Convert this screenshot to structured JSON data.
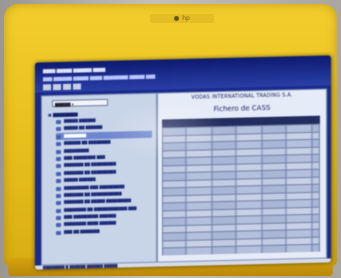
{
  "monitor": {
    "brand_logo": "hp"
  },
  "app": {
    "company_name": "VODAS INTERNATIONAL TRADING S.A.",
    "panel_title": "Fichero de CASS"
  },
  "icons": [
    "hp-logo",
    "folder-icon",
    "grid-icon"
  ],
  "colors": {
    "bezel": "#e7bf1c",
    "screen_bg": "#1a2a8c",
    "grid": "#6e7ea6"
  }
}
